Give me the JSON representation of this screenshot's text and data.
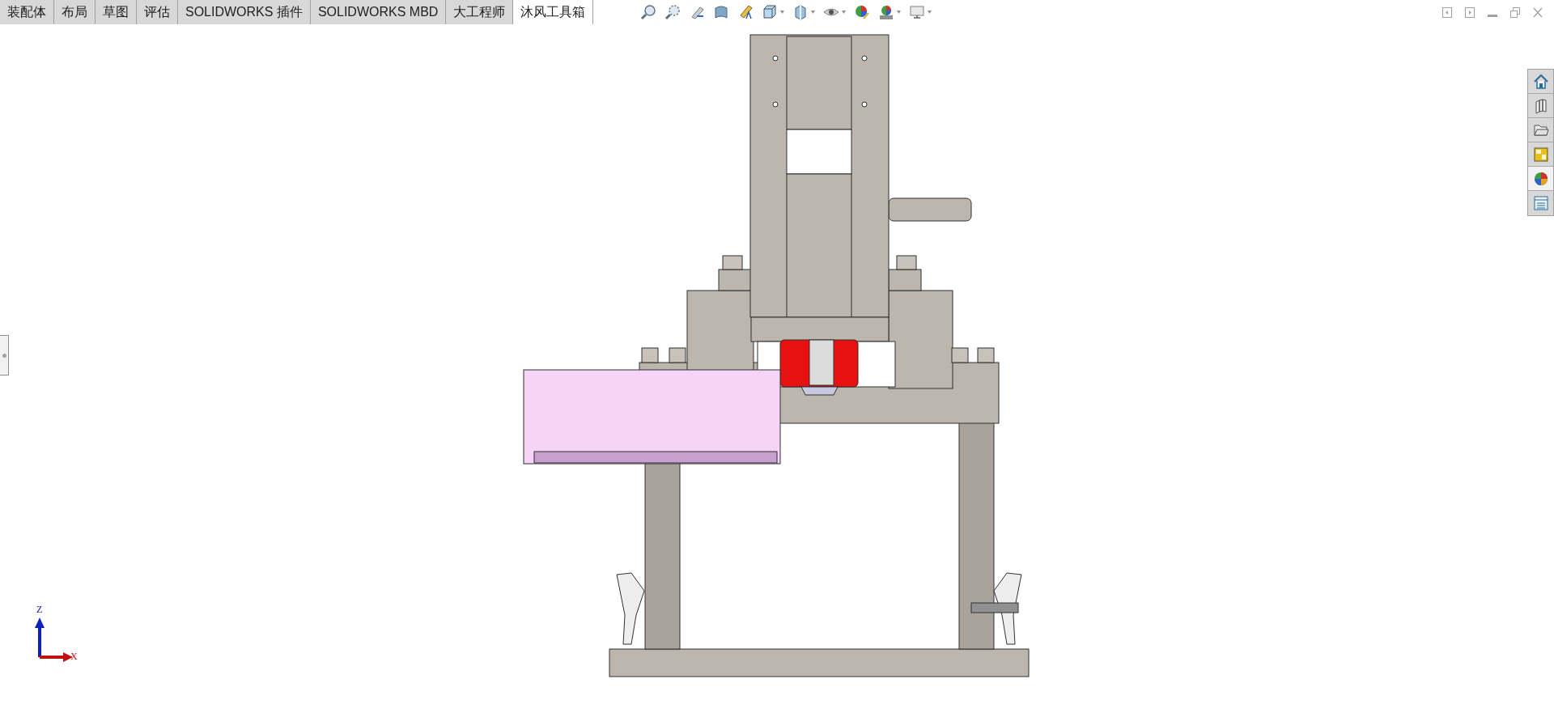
{
  "command_manager": {
    "tabs": [
      {
        "label": "装配体",
        "selected": false
      },
      {
        "label": "布局",
        "selected": false
      },
      {
        "label": "草图",
        "selected": false
      },
      {
        "label": "评估",
        "selected": false
      },
      {
        "label": "SOLIDWORKS 插件",
        "selected": false
      },
      {
        "label": "SOLIDWORKS MBD",
        "selected": false
      },
      {
        "label": "大工程师",
        "selected": false
      },
      {
        "label": "沐风工具箱",
        "selected": true
      }
    ]
  },
  "triad": {
    "z_label": "Z",
    "x_label": "X"
  }
}
